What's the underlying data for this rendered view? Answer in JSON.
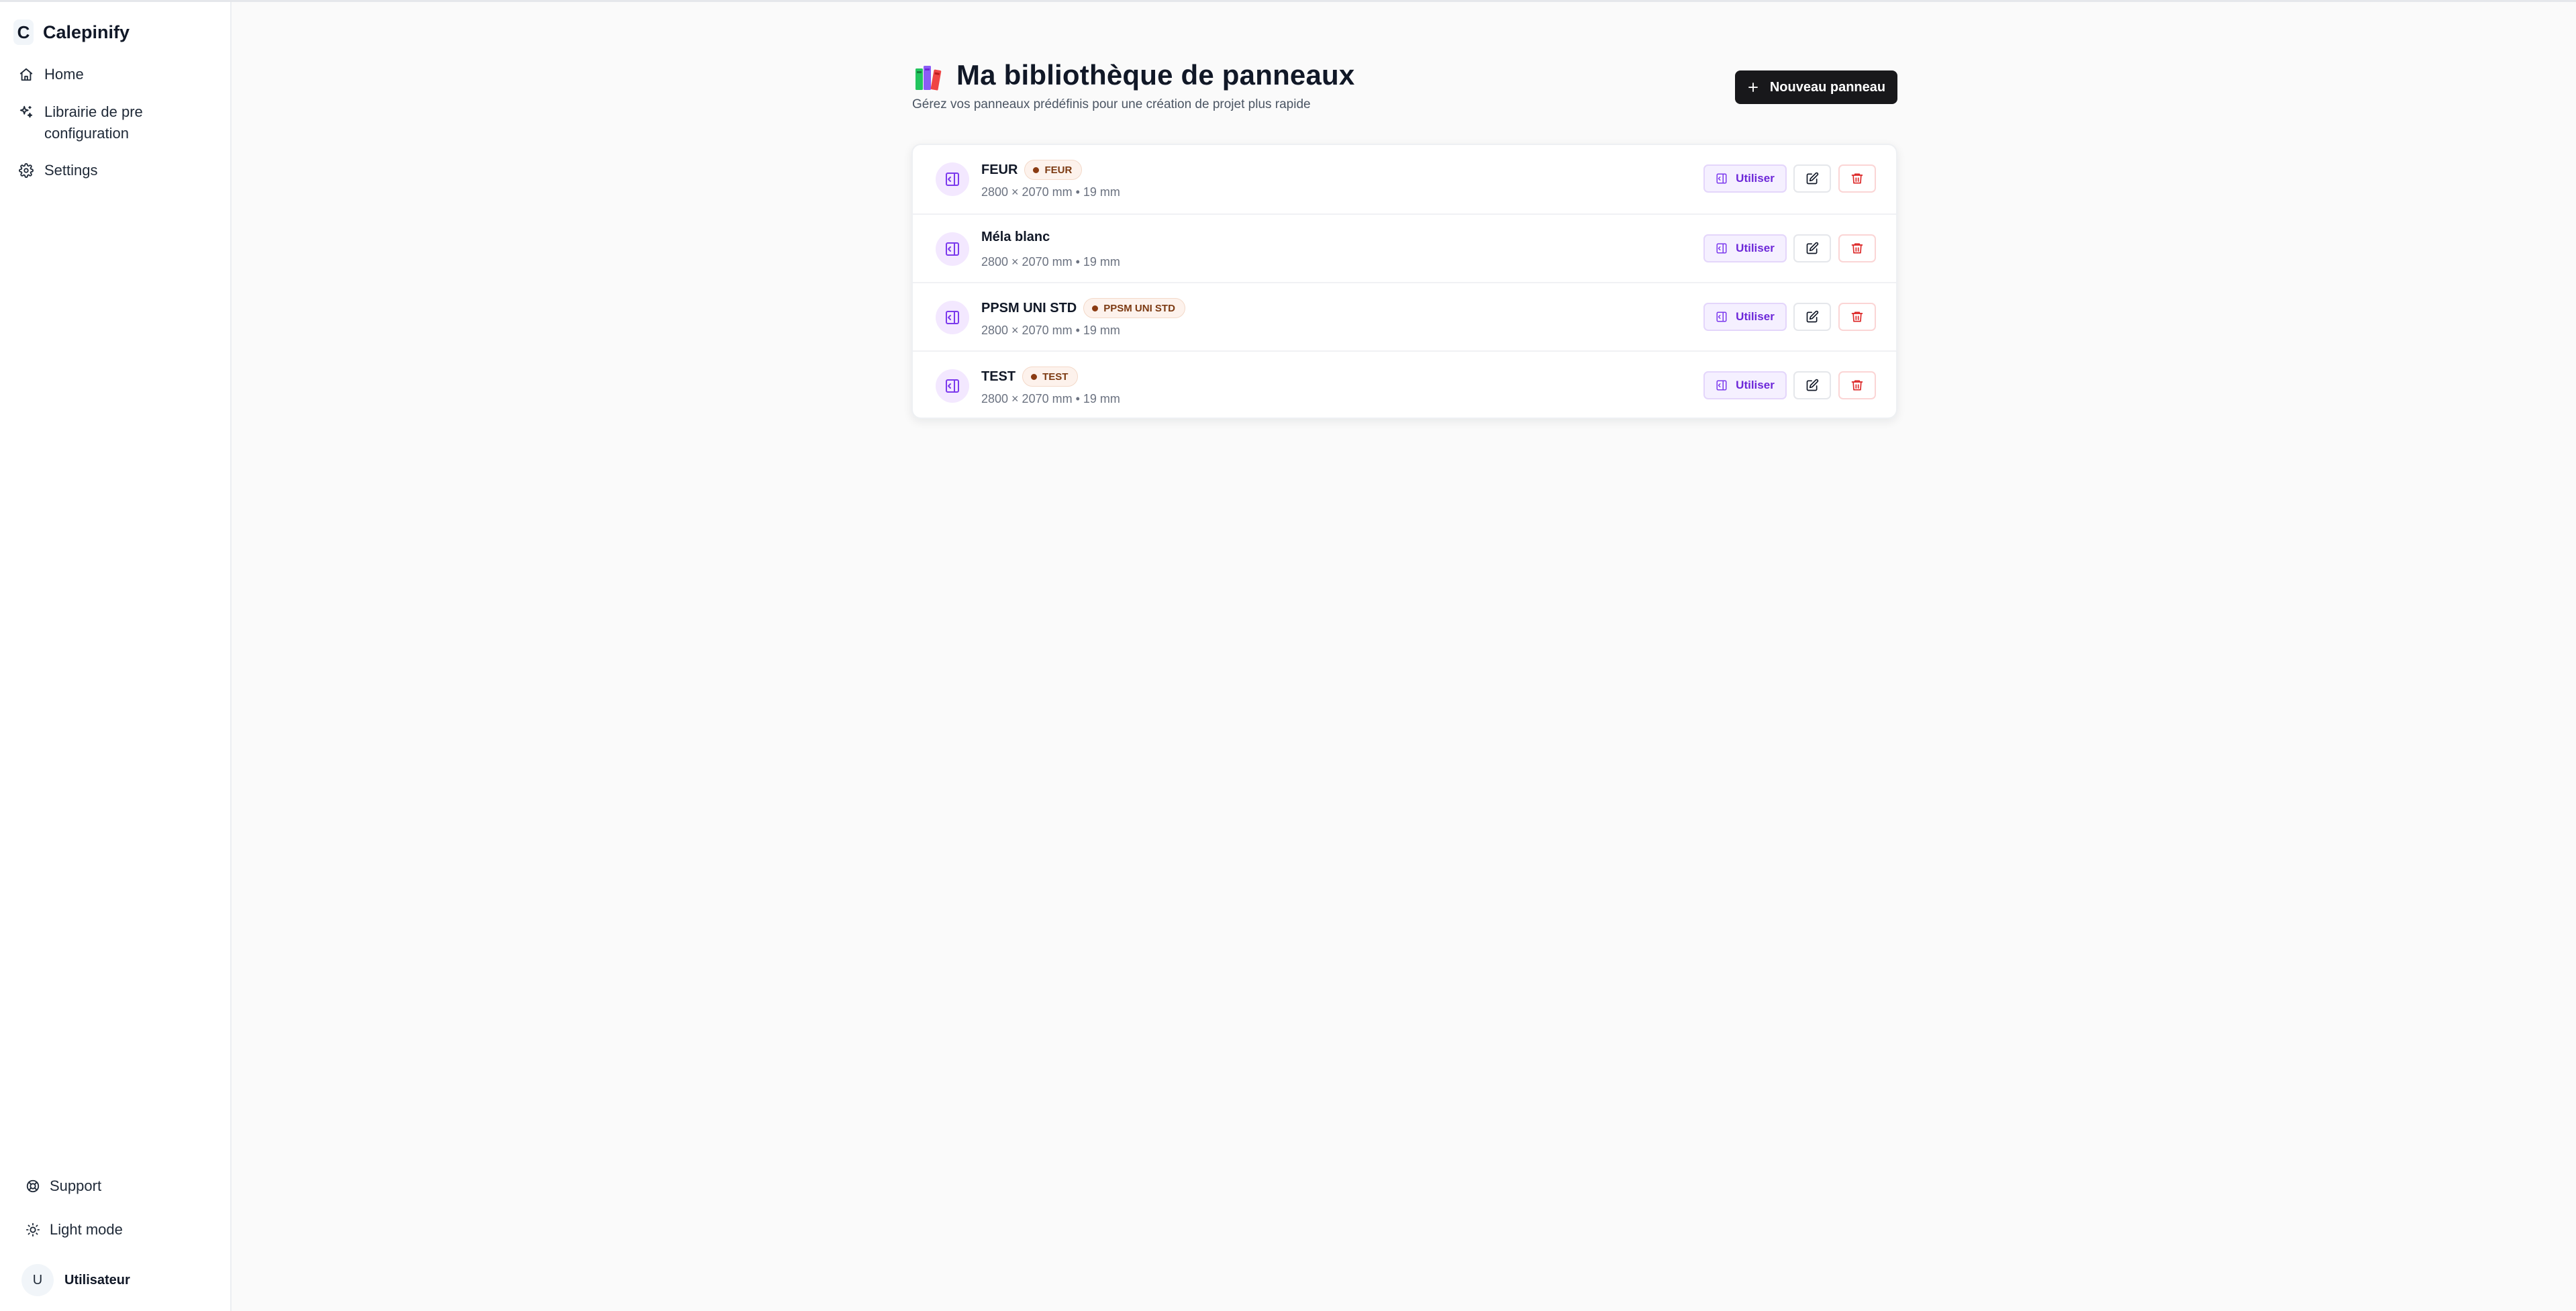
{
  "sidebar": {
    "brand_letter": "C",
    "brand_name": "Calepinify",
    "nav": [
      {
        "label": "Home",
        "icon": "home-icon"
      },
      {
        "label": "Librairie de pre configuration",
        "icon": "sparkles-icon"
      },
      {
        "label": "Settings",
        "icon": "gear-icon"
      }
    ],
    "bottom": [
      {
        "label": "Support",
        "icon": "lifebuoy-icon"
      },
      {
        "label": "Light mode",
        "icon": "sun-icon"
      }
    ],
    "user": {
      "initial": "U",
      "name": "Utilisateur"
    }
  },
  "header": {
    "emoji": "books-emoji",
    "title": "Ma bibliothèque de panneaux",
    "subtitle": "Gérez vos panneaux prédéfinis pour une création de projet plus rapide",
    "new_button_label": "Nouveau panneau"
  },
  "panels": [
    {
      "name": "FEUR",
      "tag": "FEUR",
      "meta": "2800 × 2070 mm • 19 mm"
    },
    {
      "name": "Méla blanc",
      "tag": "",
      "meta": "2800 × 2070 mm • 19 mm"
    },
    {
      "name": "PPSM UNI STD",
      "tag": "PPSM UNI STD",
      "meta": "2800 × 2070 mm • 19 mm"
    },
    {
      "name": "TEST",
      "tag": "TEST",
      "meta": "2800 × 2070 mm • 19 mm"
    }
  ],
  "row_actions": {
    "use_label": "Utiliser"
  },
  "colors": {
    "accent_purple": "#6d28d9",
    "danger_red": "#dc2626",
    "primary_dark": "#18181b",
    "tag_dot": "#8a3b12"
  }
}
